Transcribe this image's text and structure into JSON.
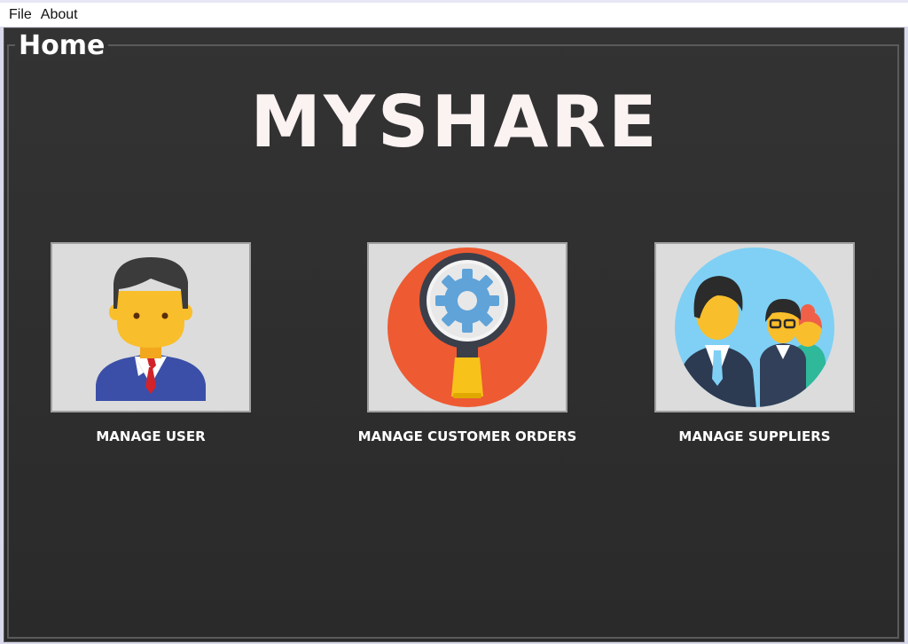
{
  "menubar": {
    "items": [
      "File",
      "About"
    ]
  },
  "home": {
    "group_title": "Home",
    "app_title": "MYSHARE",
    "tiles": [
      {
        "label": "MANAGE USER",
        "icon": "user-icon"
      },
      {
        "label": "MANAGE CUSTOMER ORDERS",
        "icon": "magnifier-gear-icon"
      },
      {
        "label": "MANAGE SUPPLIERS",
        "icon": "team-icon"
      }
    ]
  },
  "colors": {
    "background": "#2e2e2e",
    "title_text": "#fbf2f2",
    "tile_background": "#dcdcdc",
    "orders_circle": "#ee5a32",
    "suppliers_circle": "#7fd0f4",
    "user_suit": "#3b4fa8",
    "skin": "#f9be2b"
  }
}
